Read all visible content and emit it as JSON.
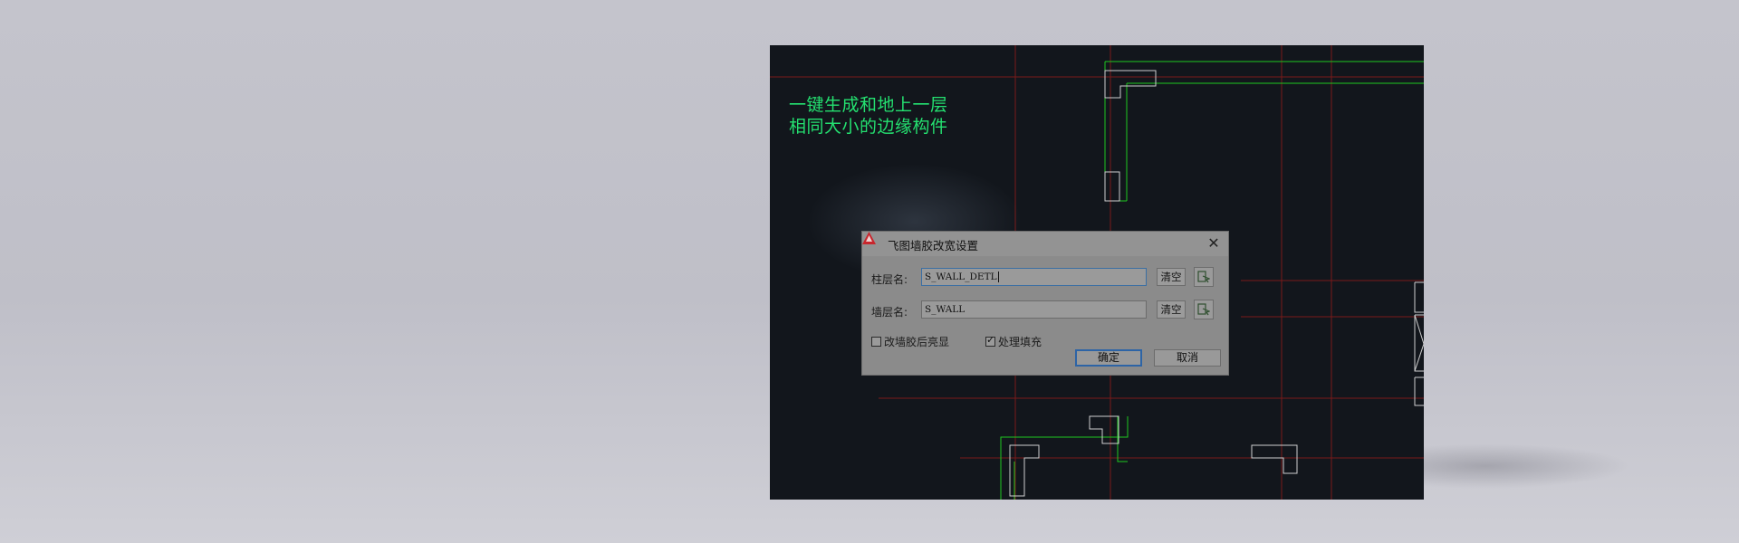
{
  "caption": {
    "line1": "一键生成和地上一层",
    "line2": "相同大小的边缘构件"
  },
  "dialog": {
    "title": "飞图墙胶改宽设置",
    "close_glyph": "✕",
    "column_layer": {
      "label": "柱层名:",
      "value": "S_WALL_DETL"
    },
    "wall_layer": {
      "label": "墙层名:",
      "value": "S_WALL"
    },
    "clear_label": "清空",
    "highlight_option": {
      "label": "改墙胶后亮显",
      "checked": false
    },
    "fill_option": {
      "label": "处理填充",
      "checked": true
    },
    "ok_label": "确定",
    "cancel_label": "取消"
  },
  "icons": {
    "app": "autocad-logo-icon",
    "close": "close-icon",
    "pick": "layer-pick-icon"
  },
  "colors": {
    "canvas_background": "#12161c",
    "caption_text": "#24e070",
    "outline_green": "#1fc81f",
    "grid_red": "#7a1a1a",
    "outline_white": "#cfcfcf",
    "dialog_background": "#8b8b8b",
    "primary_button_border": "#2d64a6"
  }
}
